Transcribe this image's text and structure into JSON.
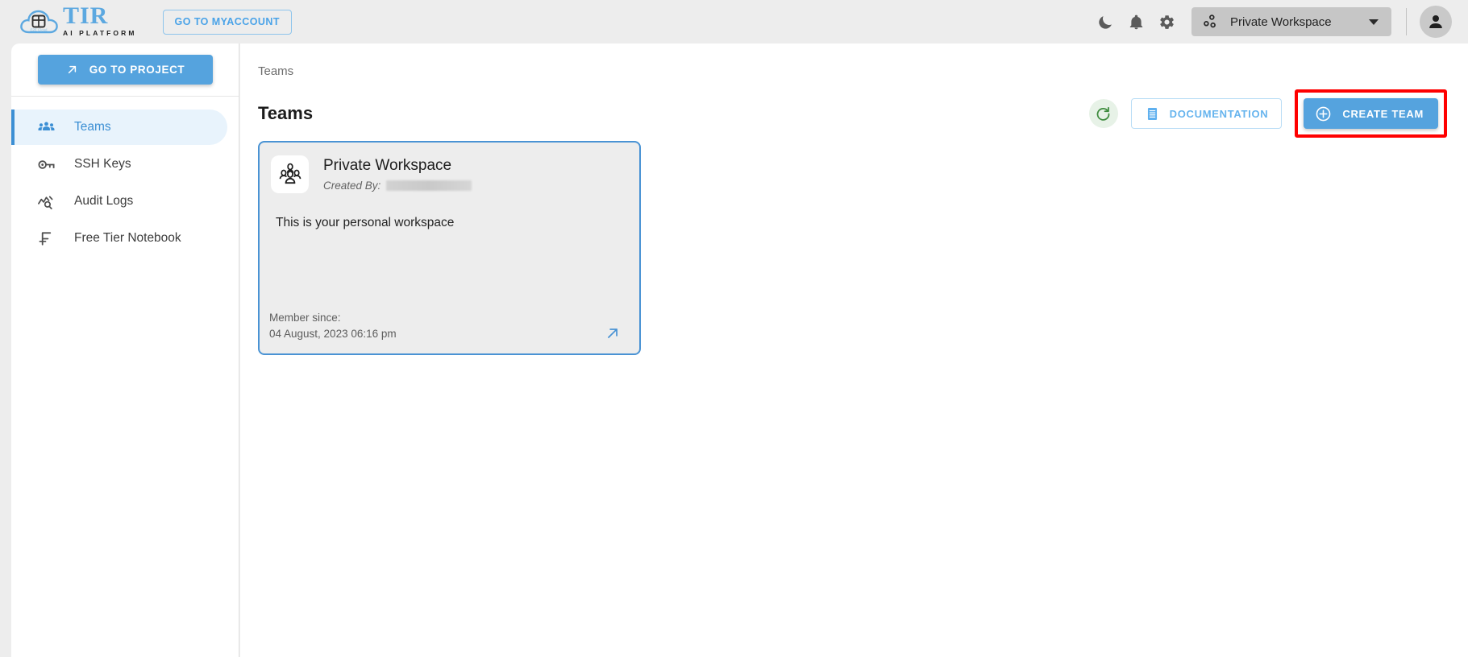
{
  "header": {
    "logo": {
      "icon": "cloud-grid-logo-icon",
      "title": "TIR",
      "subtitle": "AI PLATFORM"
    },
    "myaccount_label": "GO TO MYACCOUNT",
    "icons": {
      "dark_mode": "moon-icon",
      "notifications": "bell-icon",
      "settings": "gear-icon",
      "workspace": "workspace-nodes-icon",
      "caret": "chevron-down-icon",
      "avatar": "user-avatar-icon"
    },
    "workspace_selected": "Private Workspace"
  },
  "sidebar": {
    "go_to_project_label": "GO TO PROJECT",
    "go_to_project_icon": "arrow-up-right-icon",
    "items": [
      {
        "label": "Teams",
        "icon": "people-group-icon",
        "active": true
      },
      {
        "label": "SSH Keys",
        "icon": "key-icon",
        "active": false
      },
      {
        "label": "Audit Logs",
        "icon": "chart-search-icon",
        "active": false
      },
      {
        "label": "Free Tier Notebook",
        "icon": "free-tier-icon",
        "active": false
      }
    ]
  },
  "main": {
    "breadcrumb": "Teams",
    "page_title": "Teams",
    "actions": {
      "refresh_icon": "refresh-icon",
      "documentation_label": "DOCUMENTATION",
      "documentation_icon": "document-icon",
      "create_team_label": "CREATE TEAM",
      "create_team_icon": "plus-circle-icon"
    },
    "cards": [
      {
        "icon": "team-people-icon",
        "title": "Private Workspace",
        "created_by_label": "Created By:",
        "created_by_value": "",
        "description": "This is your personal workspace",
        "member_since_label": "Member since:",
        "member_since_value": "04 August, 2023 06:16 pm",
        "open_icon": "arrow-up-right-icon"
      }
    ]
  },
  "colors": {
    "accent_blue": "#55a3de",
    "nav_active_bg": "#e8f3fc",
    "nav_active_text": "#3c8fd4",
    "highlight_red": "#ff0000",
    "refresh_green": "#3d8b3d",
    "header_bg": "#ededed",
    "card_bg": "#ededed"
  }
}
